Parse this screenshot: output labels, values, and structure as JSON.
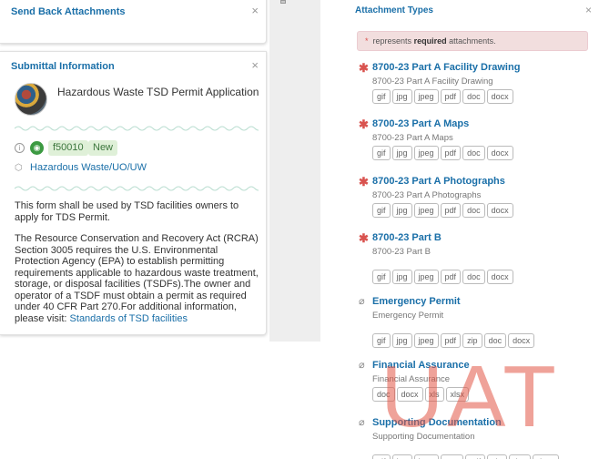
{
  "send_back": {
    "title": "Send Back Attachments",
    "close_glyph": "×"
  },
  "submittal": {
    "title": "Submittal Information",
    "close_glyph": "×",
    "app_title": "Hazardous Waste TSD Permit Application",
    "form_id": "f50010",
    "status": "New",
    "tag": "Hazardous Waste/UO/UW",
    "description_1": "This form shall be used by TSD facilities owners to apply for TDS Permit.",
    "description_2": "The Resource Conservation and Recovery Act (RCRA) Section 3005 requires the U.S. Environmental Protection Agency (EPA) to establish permitting requirements applicable to hazardous waste treatment, storage, or disposal facilities (TSDFs).The owner and operator of a TSDF must obtain a permit as required under 40 CFR Part 270.For additional information, please visit:",
    "link_text": "Standards of TSD facilities",
    "icons": {
      "info": "info-icon",
      "status": "globe-icon",
      "tag": "tag-icon"
    }
  },
  "attachment_types": {
    "title": "Attachment Types",
    "close_glyph": "×",
    "required_note_pre": "represents",
    "required_note_bold": "required",
    "required_note_post": "attachments.",
    "items": [
      {
        "name": "8700-23 Part A Facility Drawing",
        "sub": "8700-23 Part A Facility Drawing",
        "required": true,
        "exts": [
          "gif",
          "jpg",
          "jpeg",
          "pdf",
          "doc",
          "docx"
        ]
      },
      {
        "name": "8700-23 Part A Maps",
        "sub": "8700-23 Part A Maps",
        "required": true,
        "exts": [
          "gif",
          "jpg",
          "jpeg",
          "pdf",
          "doc",
          "docx"
        ]
      },
      {
        "name": "8700-23 Part A Photographs",
        "sub": "8700-23 Part A Photographs",
        "required": true,
        "exts": [
          "gif",
          "jpg",
          "jpeg",
          "pdf",
          "doc",
          "docx"
        ]
      },
      {
        "name": "8700-23 Part B",
        "sub": "8700-23 Part B",
        "required": true,
        "exts": [
          "gif",
          "jpg",
          "jpeg",
          "pdf",
          "doc",
          "docx"
        ]
      },
      {
        "name": "Emergency Permit",
        "sub": "Emergency Permit",
        "required": false,
        "exts": [
          "gif",
          "jpg",
          "jpeg",
          "pdf",
          "zip",
          "doc",
          "docx"
        ]
      },
      {
        "name": "Financial Assurance",
        "sub": "Financial Assurance",
        "required": false,
        "exts": [
          "doc",
          "docx",
          "xls",
          "xlsx"
        ]
      },
      {
        "name": "Supporting Documentation",
        "sub": "Supporting Documentation",
        "required": false,
        "exts": [
          "gif",
          "jpg",
          "jpeg",
          "png",
          "pdf",
          "zip",
          "doc",
          "docx"
        ]
      }
    ]
  },
  "watermark": "UAT",
  "colors": {
    "link": "#1a6fa8",
    "required": "#d9534f",
    "badge_bg": "#dff0d8",
    "watermark": "#e25646"
  }
}
